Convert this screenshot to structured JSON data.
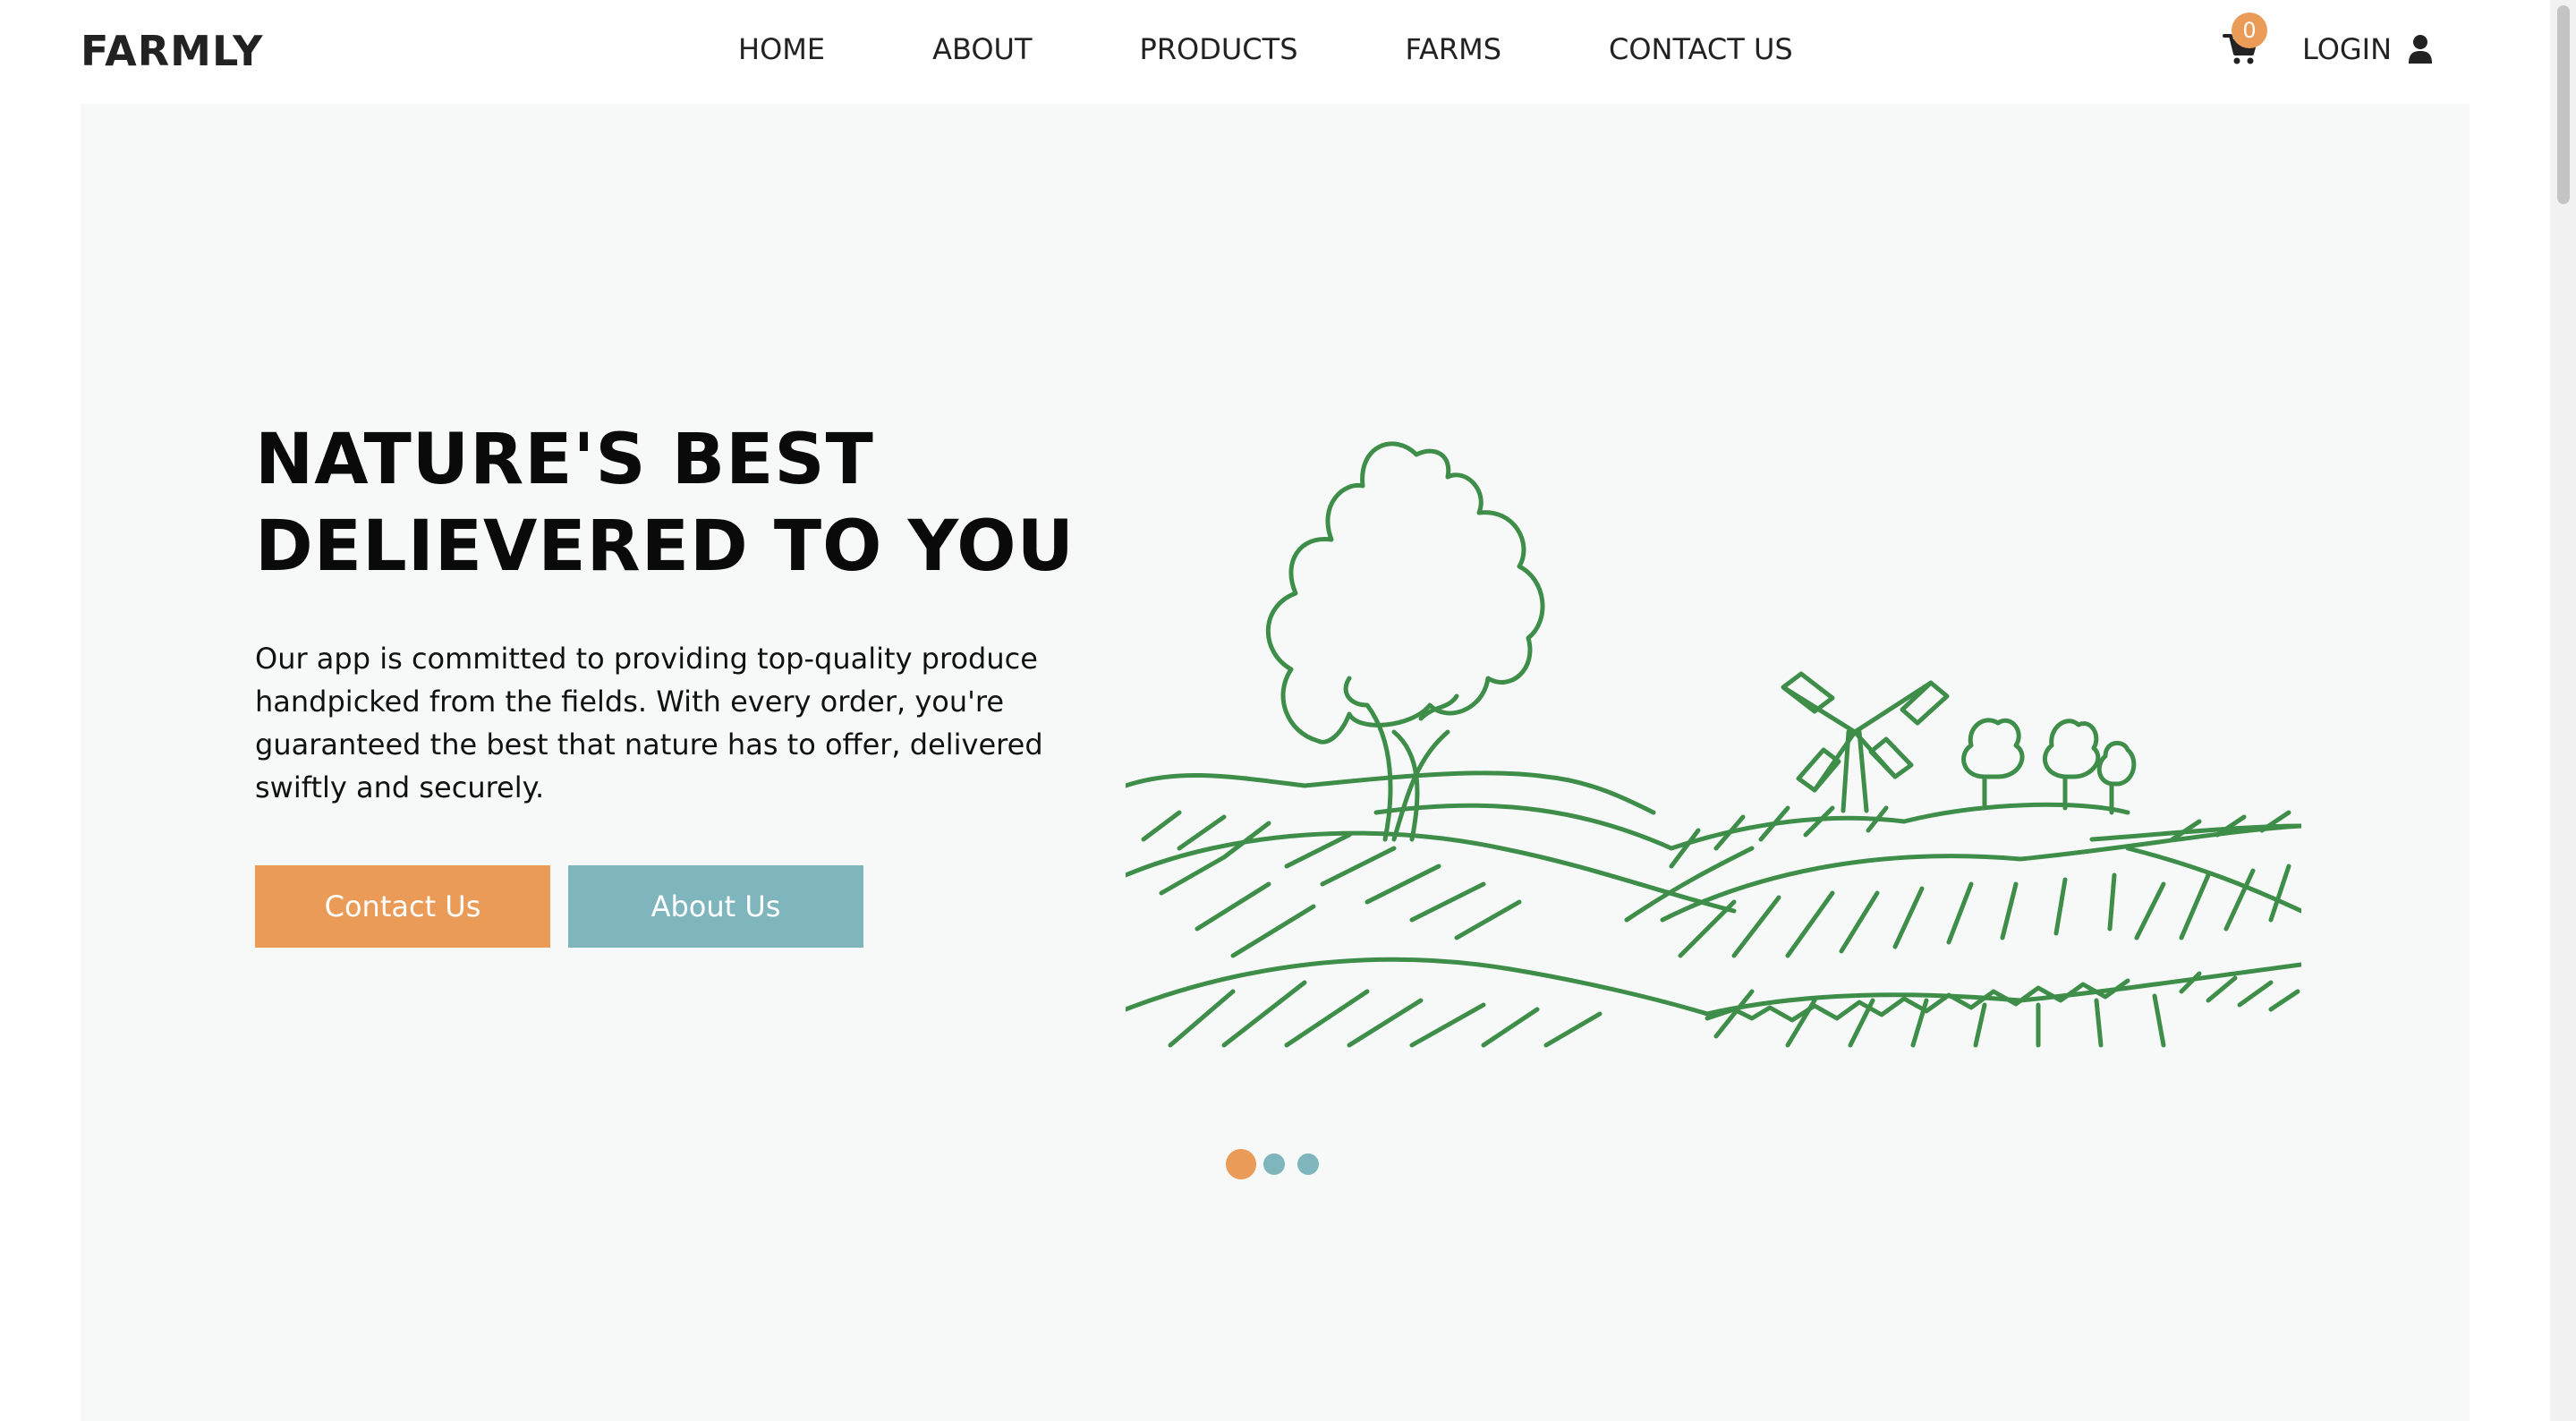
{
  "brand": {
    "logo": "FARMLY"
  },
  "nav": {
    "links": [
      {
        "label": "HOME"
      },
      {
        "label": "ABOUT"
      },
      {
        "label": "PRODUCTS"
      },
      {
        "label": "FARMS"
      },
      {
        "label": "CONTACT US"
      }
    ],
    "cart": {
      "icon": "cart-icon",
      "count": "0"
    },
    "login": {
      "label": "LOGIN",
      "icon": "user-icon"
    }
  },
  "hero": {
    "title_line1": "NATURE'S BEST",
    "title_line2": "DELIEVERED TO YOU",
    "description": "Our app is committed to providing top-quality produce handpicked from the fields. With every order, you're guaranteed the best that nature has to offer, delivered swiftly and securely.",
    "buttons": {
      "contact": "Contact Us",
      "about": "About Us"
    },
    "illustration": "farm-landscape-illustration",
    "carousel": {
      "slides": 3,
      "active_slide": 1
    }
  },
  "colors": {
    "accent_orange": "#ea9b57",
    "accent_teal": "#7fb5bc",
    "illustration_green": "#3e8e4a",
    "hero_background": "#f7f9f9"
  }
}
